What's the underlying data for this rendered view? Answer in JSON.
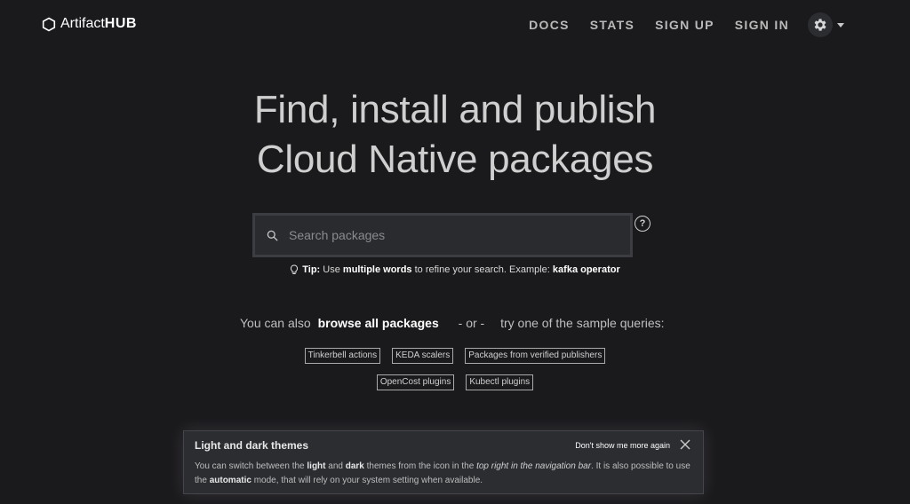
{
  "brand": {
    "name_a": "Artifact",
    "name_b": "HUB"
  },
  "nav": {
    "docs": "DOCS",
    "stats": "STATS",
    "sign_up": "SIGN UP",
    "sign_in": "SIGN IN"
  },
  "hero": {
    "line1": "Find, install and publish",
    "line2": "Cloud Native packages"
  },
  "search": {
    "placeholder": "Search packages"
  },
  "tip": {
    "label": "Tip:",
    "t1": "Use",
    "t2": "multiple words",
    "t3": "to refine your search. Example:",
    "t4": "kafka operator"
  },
  "browse": {
    "prefix": "You can also",
    "link": "browse all packages",
    "sep": "- or -",
    "suffix": "try one of the sample queries:"
  },
  "sample_queries": [
    "Tinkerbell actions",
    "KEDA scalers",
    "Packages from verified publishers",
    "OpenCost plugins",
    "Kubectl plugins"
  ],
  "toast": {
    "title": "Light and dark themes",
    "dismiss": "Don't show me more again",
    "b1": "You can switch between the",
    "b2": "light",
    "b3": "and",
    "b4": "dark",
    "b5": "themes from the icon in the",
    "b6": "top right in the navigation bar",
    "b7": ". It is also possible to use the",
    "b8": "automatic",
    "b9": "mode, that will rely on your system setting when available."
  },
  "icons": {
    "logo": "hexagon-icon",
    "settings": "gear-icon",
    "search": "search-icon",
    "help": "question-circle-icon",
    "tip": "lightbulb-icon",
    "close": "close-icon"
  },
  "colors": {
    "background": "#1a191c",
    "toast_bg": "#2b2d31",
    "search_bg": "#2a2b2f"
  }
}
